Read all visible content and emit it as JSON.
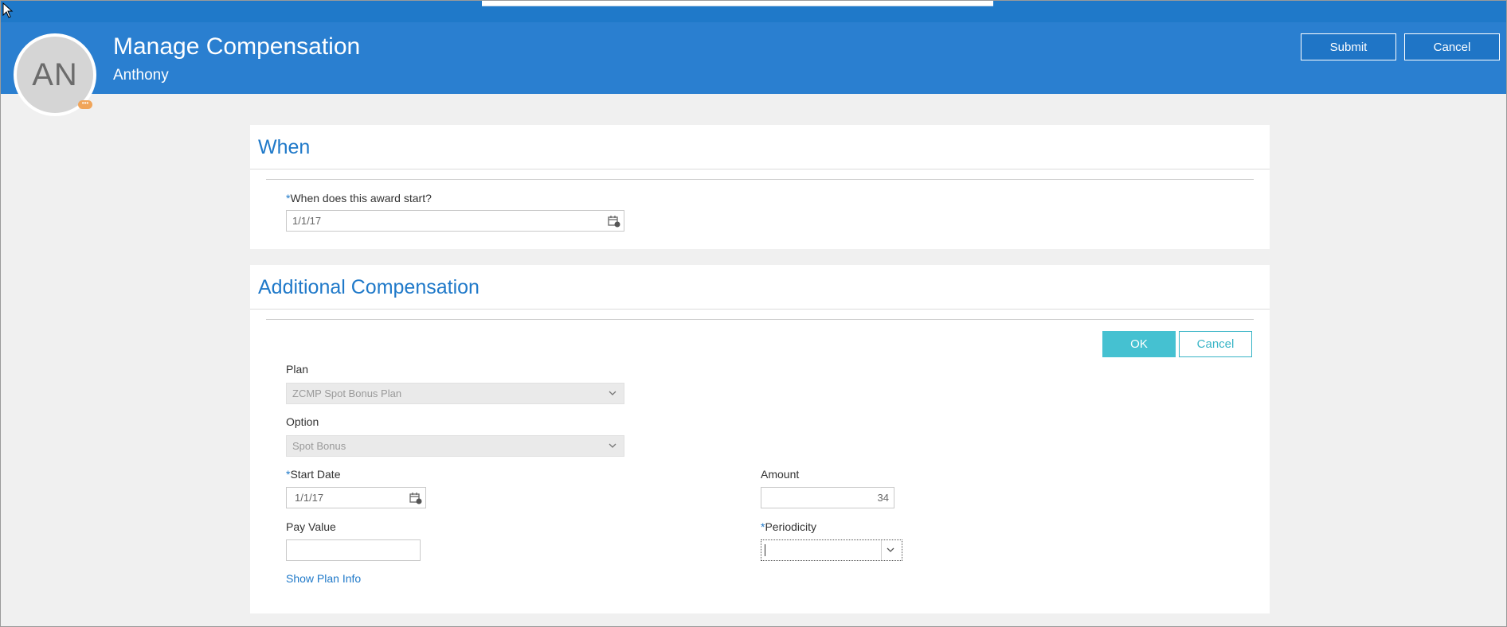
{
  "header": {
    "initials": "AN",
    "badge": "•••",
    "title": "Manage Compensation",
    "subtitle": "Anthony",
    "submit_label": "Submit",
    "cancel_label": "Cancel"
  },
  "when": {
    "title": "When",
    "start_label": "When does this award start?",
    "start_value": "1/1/17"
  },
  "additional": {
    "title": "Additional Compensation",
    "ok_label": "OK",
    "cancel_label": "Cancel",
    "plan_label": "Plan",
    "plan_value": "ZCMP Spot Bonus Plan",
    "option_label": "Option",
    "option_value": "Spot Bonus",
    "start_date_label": "Start Date",
    "start_date_value": "1/1/17",
    "amount_label": "Amount",
    "amount_value": "34",
    "pay_value_label": "Pay Value",
    "pay_value_value": "",
    "periodicity_label": "Periodicity",
    "periodicity_value": "",
    "show_plan_info": "Show Plan Info"
  },
  "required_marker": "*",
  "colors": {
    "brand_blue": "#2a7fd0",
    "accent_teal": "#45c1d1",
    "link_blue": "#1f79c9"
  }
}
